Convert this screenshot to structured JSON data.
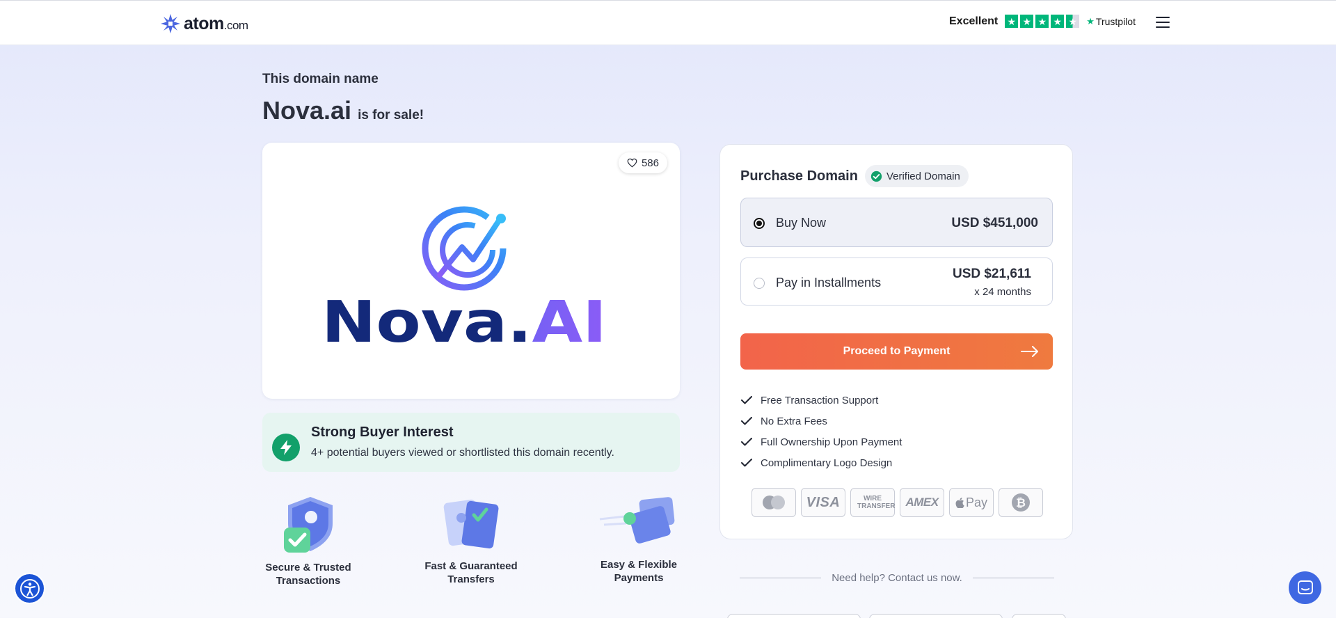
{
  "header": {
    "logo_text": "atom",
    "logo_suffix": ".com",
    "trust_label": "Excellent",
    "trustpilot_text": "Trustpilot",
    "rating_stars": 4.5
  },
  "page": {
    "pre_title": "This domain name",
    "domain": "Nova.ai",
    "sale_text": "is for sale!"
  },
  "domain_card": {
    "likes": "586",
    "logo_wordmark": "Nova.AI"
  },
  "interest": {
    "title": "Strong Buyer Interest",
    "text": "4+ potential buyers viewed or shortlisted this domain recently."
  },
  "features": [
    {
      "label_line1": "Secure & Trusted",
      "label_line2": "Transactions"
    },
    {
      "label_line1": "Fast & Guaranteed",
      "label_line2": "Transfers"
    },
    {
      "label_line1": "Easy & Flexible",
      "label_line2": "Payments"
    }
  ],
  "purchase": {
    "title": "Purchase Domain",
    "verified_badge": "Verified Domain",
    "options": [
      {
        "label": "Buy Now",
        "price": "USD $451,000",
        "selected": true
      },
      {
        "label": "Pay in Installments",
        "price": "USD $21,611",
        "sub": "x 24 months",
        "selected": false
      }
    ],
    "proceed_label": "Proceed to Payment",
    "benefits": [
      "Free Transaction Support",
      "No Extra Fees",
      "Full Ownership Upon Payment",
      "Complimentary Logo Design"
    ],
    "payment_methods": {
      "visa": "VISA",
      "wire": "WIRE TRANSFER",
      "amex": "AMEX",
      "applepay": "Pay"
    }
  },
  "help_text": "Need help? Contact us now.",
  "colors": {
    "accent_orange": "#f2644a",
    "verified_green": "#12a06a",
    "trustpilot_green": "#00b67a",
    "brand_navy": "#13297a",
    "brand_blue": "#3b82f6",
    "brand_purple": "#8b5cf6"
  }
}
